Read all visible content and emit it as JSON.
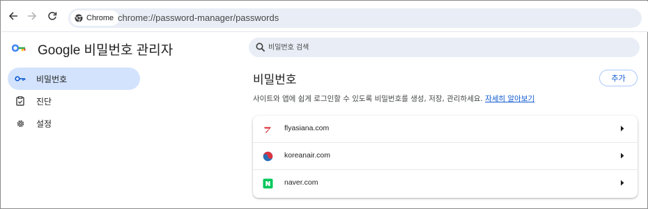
{
  "toolbar": {
    "back_icon": "back-arrow-icon",
    "forward_icon": "forward-arrow-icon",
    "reload_icon": "reload-icon",
    "chip_label": "Chrome",
    "url": "chrome://password-manager/passwords"
  },
  "app": {
    "title": "Google 비밀번호 관리자"
  },
  "sidebar": {
    "items": [
      {
        "label": "비밀번호",
        "icon": "key-icon",
        "active": true
      },
      {
        "label": "진단",
        "icon": "clipboard-check-icon",
        "active": false
      },
      {
        "label": "설정",
        "icon": "gear-icon",
        "active": false
      }
    ]
  },
  "search": {
    "placeholder": "비밀번호 검색"
  },
  "main": {
    "title": "비밀번호",
    "add_label": "추가",
    "description": "사이트와 앱에 쉽게 로그인할 수 있도록 비밀번호를 생성, 저장, 관리하세요.",
    "learn_more": "자세히 알아보기",
    "passwords": [
      {
        "site": "flyasiana.com",
        "icon": "asiana-favicon"
      },
      {
        "site": "koreanair.com",
        "icon": "koreanair-favicon"
      },
      {
        "site": "naver.com",
        "icon": "naver-favicon"
      }
    ]
  },
  "colors": {
    "accent": "#0b57d0",
    "active_bg": "#d3e3fd",
    "omnibox_bg": "#e9eef6",
    "naver_green": "#03c75a",
    "asiana_red": "#d9232d"
  }
}
